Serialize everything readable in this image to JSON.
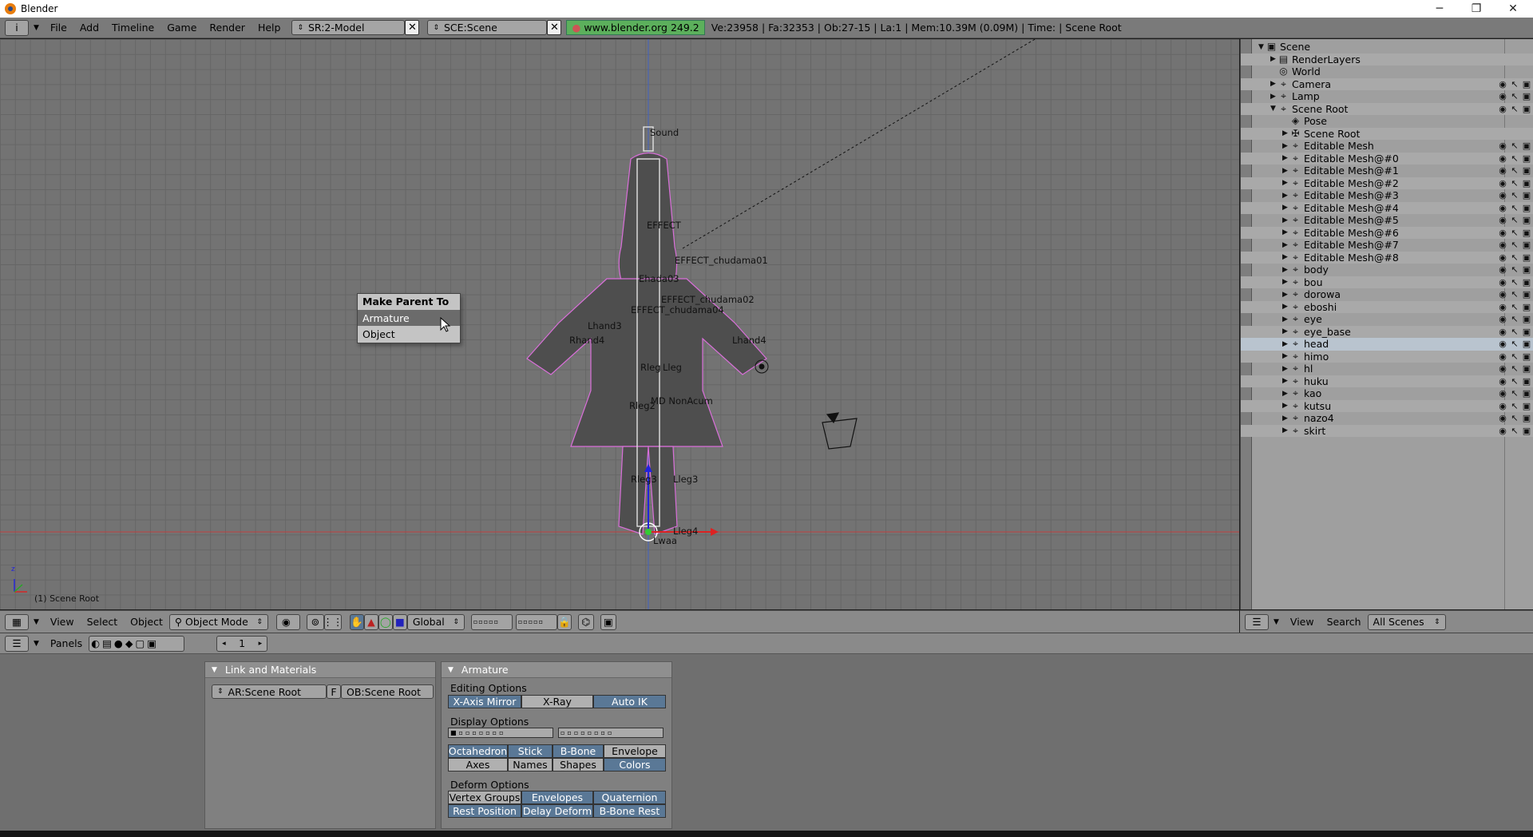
{
  "window": {
    "title": "Blender",
    "min": "─",
    "max": "❐",
    "close": "✕"
  },
  "topbar": {
    "menus": [
      "File",
      "Add",
      "Timeline",
      "Game",
      "Render",
      "Help"
    ],
    "screen_field": "SR:2-Model",
    "scene_field": "SCE:Scene",
    "website": "www.blender.org 249.2",
    "stats": "Ve:23958 | Fa:32353 | Ob:27-15 | La:1  | Mem:10.39M (0.09M)  | Time: | Scene Root"
  },
  "viewport": {
    "corner_label": "(1) Scene Root",
    "axis_z": "z",
    "bone_labels": [
      "Sound",
      "EFFECT",
      "EFFECT_chudama01",
      "Ehada03",
      "EFFECT_chudama02",
      "EFFECT_chudama04",
      "Lhand3",
      "Rhand4",
      "Lhand4",
      "Rleg",
      "Lleg",
      "Rleg2",
      "MD NonAcum",
      "Rleg3",
      "Lleg3",
      "Lleg4",
      "Lwaa"
    ]
  },
  "popup": {
    "title": "Make Parent To",
    "items": [
      "Armature",
      "Object"
    ]
  },
  "view3d_header": {
    "menus": [
      "View",
      "Select",
      "Object"
    ],
    "mode": "Object Mode",
    "orientation": "Global"
  },
  "outliner": {
    "rows": [
      {
        "label": "Scene",
        "indent": 0,
        "icon": "scene",
        "arrow": "down"
      },
      {
        "label": "RenderLayers",
        "indent": 1,
        "icon": "renderlayers",
        "arrow": "right"
      },
      {
        "label": "World",
        "indent": 1,
        "icon": "world",
        "arrow": ""
      },
      {
        "label": "Camera",
        "indent": 1,
        "icon": "object",
        "arrow": "right",
        "vis": true
      },
      {
        "label": "Lamp",
        "indent": 1,
        "icon": "object",
        "arrow": "right",
        "vis": true
      },
      {
        "label": "Scene Root",
        "indent": 1,
        "icon": "object",
        "arrow": "down",
        "vis": true
      },
      {
        "label": "Pose",
        "indent": 2,
        "icon": "pose",
        "arrow": ""
      },
      {
        "label": "Scene Root",
        "indent": 2,
        "icon": "armature",
        "arrow": "right"
      },
      {
        "label": "Editable Mesh",
        "indent": 2,
        "icon": "object",
        "arrow": "right",
        "vis": true
      },
      {
        "label": "Editable Mesh@#0",
        "indent": 2,
        "icon": "object",
        "arrow": "right",
        "vis": true
      },
      {
        "label": "Editable Mesh@#1",
        "indent": 2,
        "icon": "object",
        "arrow": "right",
        "vis": true
      },
      {
        "label": "Editable Mesh@#2",
        "indent": 2,
        "icon": "object",
        "arrow": "right",
        "vis": true
      },
      {
        "label": "Editable Mesh@#3",
        "indent": 2,
        "icon": "object",
        "arrow": "right",
        "vis": true
      },
      {
        "label": "Editable Mesh@#4",
        "indent": 2,
        "icon": "object",
        "arrow": "right",
        "vis": true
      },
      {
        "label": "Editable Mesh@#5",
        "indent": 2,
        "icon": "object",
        "arrow": "right",
        "vis": true
      },
      {
        "label": "Editable Mesh@#6",
        "indent": 2,
        "icon": "object",
        "arrow": "right",
        "vis": true
      },
      {
        "label": "Editable Mesh@#7",
        "indent": 2,
        "icon": "object",
        "arrow": "right",
        "vis": true
      },
      {
        "label": "Editable Mesh@#8",
        "indent": 2,
        "icon": "object",
        "arrow": "right",
        "vis": true
      },
      {
        "label": "body",
        "indent": 2,
        "icon": "object",
        "arrow": "right",
        "vis": true
      },
      {
        "label": "bou",
        "indent": 2,
        "icon": "object",
        "arrow": "right",
        "vis": true
      },
      {
        "label": "dorowa",
        "indent": 2,
        "icon": "object",
        "arrow": "right",
        "vis": true
      },
      {
        "label": "eboshi",
        "indent": 2,
        "icon": "object",
        "arrow": "right",
        "vis": true
      },
      {
        "label": "eye",
        "indent": 2,
        "icon": "object",
        "arrow": "right",
        "vis": true
      },
      {
        "label": "eye_base",
        "indent": 2,
        "icon": "object",
        "arrow": "right",
        "vis": true
      },
      {
        "label": "head",
        "indent": 2,
        "icon": "object",
        "arrow": "right",
        "vis": true
      },
      {
        "label": "himo",
        "indent": 2,
        "icon": "object",
        "arrow": "right",
        "vis": true
      },
      {
        "label": "hl",
        "indent": 2,
        "icon": "object",
        "arrow": "right",
        "vis": true
      },
      {
        "label": "huku",
        "indent": 2,
        "icon": "object",
        "arrow": "right",
        "vis": true
      },
      {
        "label": "kao",
        "indent": 2,
        "icon": "object",
        "arrow": "right",
        "vis": true
      },
      {
        "label": "kutsu",
        "indent": 2,
        "icon": "object",
        "arrow": "right",
        "vis": true
      },
      {
        "label": "nazo4",
        "indent": 2,
        "icon": "object",
        "arrow": "right",
        "vis": true
      },
      {
        "label": "skirt",
        "indent": 2,
        "icon": "object",
        "arrow": "right",
        "vis": true
      }
    ],
    "highlight": "head"
  },
  "outliner_header": {
    "menus": [
      "View",
      "Search"
    ],
    "filter": "All Scenes"
  },
  "buttons_header": {
    "panels_label": "Panels",
    "frame": "1"
  },
  "link_panel": {
    "title": "Link and Materials",
    "ar_field": "AR:Scene Root",
    "f_btn": "F",
    "ob_field": "OB:Scene Root"
  },
  "armature_panel": {
    "title": "Armature",
    "editing_label": "Editing Options",
    "editing": [
      {
        "label": "X-Axis Mirror",
        "on": true
      },
      {
        "label": "X-Ray",
        "on": false
      },
      {
        "label": "Auto IK",
        "on": true
      }
    ],
    "display_label": "Display Options",
    "display_row1": [
      {
        "label": "Octahedron",
        "on": true
      },
      {
        "label": "Stick",
        "on": true
      },
      {
        "label": "B-Bone",
        "on": true
      },
      {
        "label": "Envelope",
        "on": false
      }
    ],
    "display_row2": [
      {
        "label": "Axes",
        "on": false
      },
      {
        "label": "Names",
        "on": false
      },
      {
        "label": "Shapes",
        "on": false
      },
      {
        "label": "Colors",
        "on": true
      }
    ],
    "deform_label": "Deform Options",
    "deform_row1": [
      {
        "label": "Vertex Groups",
        "on": false
      },
      {
        "label": "Envelopes",
        "on": true
      },
      {
        "label": "Quaternion",
        "on": true
      }
    ],
    "deform_row2": [
      {
        "label": "Rest Position",
        "on": true
      },
      {
        "label": "Delay Deform",
        "on": true
      },
      {
        "label": "B-Bone Rest",
        "on": true
      }
    ]
  },
  "colors": {
    "accent_on": "#5a7896",
    "viewport_bg": "#737373",
    "outline_pink": "#d96fd9",
    "green_box": "#5cb05c"
  }
}
